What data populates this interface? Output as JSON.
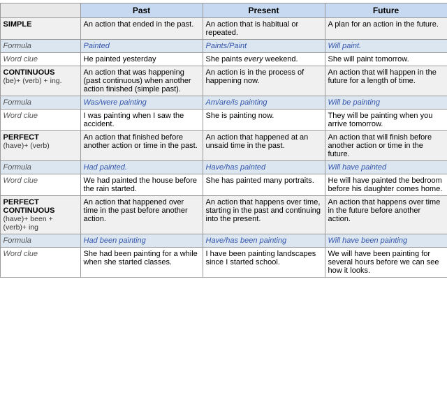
{
  "headers": {
    "label_col": "",
    "past": "Past",
    "present": "Present",
    "future": "Future"
  },
  "sections": [
    {
      "id": "simple",
      "title": "SIMPLE",
      "subtitle": "",
      "definition": {
        "past": "An action that ended in the past.",
        "present": "An action that is habitual or repeated.",
        "future": "A plan for an action in the future."
      },
      "formula": {
        "label": "Formula",
        "past": "Painted",
        "present": "Paints/Paint",
        "future": "Will paint."
      },
      "wordclue": {
        "label": "Word clue",
        "past": "He painted yesterday",
        "present": "She paints every weekend.",
        "present_em": "every",
        "future": "She will paint tomorrow."
      }
    },
    {
      "id": "continuous",
      "title": "CONTINUOUS",
      "subtitle": "(be)+ (verb) + ing.",
      "definition": {
        "past": "An action that was happening (past continuous) when another action finished (simple past).",
        "present": "An action is in the process of happening now.",
        "future": "An action that will happen in the future for a length of time."
      },
      "formula": {
        "label": "Formula",
        "past": "Was/were painting",
        "present": "Am/are/is painting",
        "future": "Will be painting"
      },
      "wordclue": {
        "label": "Word clue",
        "past": "I was painting when I saw the accident.",
        "present": "She is painting now.",
        "future": "They will be painting when you arrive tomorrow."
      }
    },
    {
      "id": "perfect",
      "title": "PERFECT",
      "subtitle": "(have)+ (verb)",
      "definition": {
        "past": "An action that finished before another action or time in the past.",
        "present": "An action that happened at an unsaid time in the past.",
        "future": "An action that will finish before another action or time in the future."
      },
      "formula": {
        "label": "Formula",
        "past": "Had painted.",
        "present": "Have/has painted",
        "future": "Will have painted"
      },
      "wordclue": {
        "label": "Word clue",
        "past": "We had painted the house before the rain started.",
        "present": "She has painted many portraits.",
        "future": "He will have painted the bedroom before his daughter comes home."
      }
    },
    {
      "id": "perfect-continuous",
      "title": "PERFECT CONTINUOUS",
      "subtitle": "(have)+ been + (verb)+ ing",
      "definition": {
        "past": "An action that happened over time in the past before another action.",
        "present": "An action that happens over time, starting in the past and continuing into the present.",
        "future": "An action that happens over time in the future before another action."
      },
      "formula": {
        "label": "Formula",
        "past": "Had been painting",
        "present": "Have/has been painting",
        "future": "Will have been painting"
      },
      "wordclue": {
        "label": "Word clue",
        "past": "She had been painting for a while when she started classes.",
        "present": "I have been painting landscapes since I started school.",
        "future": "We will have been painting for several hours before we can see how it looks."
      }
    }
  ]
}
